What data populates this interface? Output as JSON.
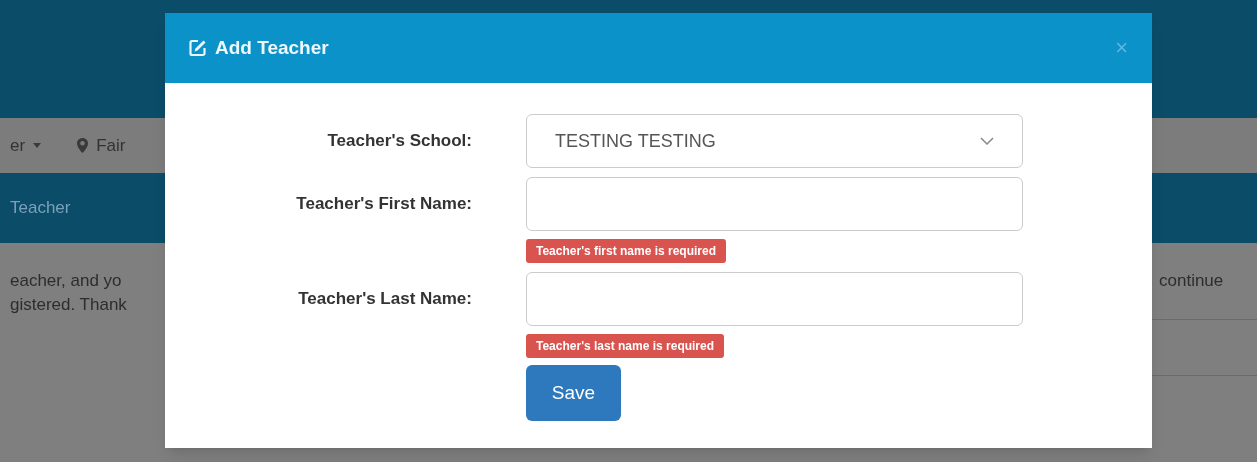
{
  "background": {
    "nav_items": [
      {
        "kind": "dropdown",
        "label": "er"
      },
      {
        "kind": "location",
        "label": "Fair"
      }
    ],
    "band_label": "Teacher",
    "text_lines": [
      "eacher, and yo",
      "gistered. Thank"
    ],
    "right_text": "continue"
  },
  "dialog": {
    "title": "Add Teacher",
    "close": "×",
    "fields": [
      {
        "kind": "select",
        "label": "Teacher's School:",
        "value": "TESTING TESTING"
      },
      {
        "kind": "text",
        "label": "Teacher's First Name:",
        "error": "Teacher's first name is required"
      },
      {
        "kind": "text",
        "label": "Teacher's Last Name:",
        "error": "Teacher's last name is required"
      }
    ],
    "save_button": "Save"
  }
}
